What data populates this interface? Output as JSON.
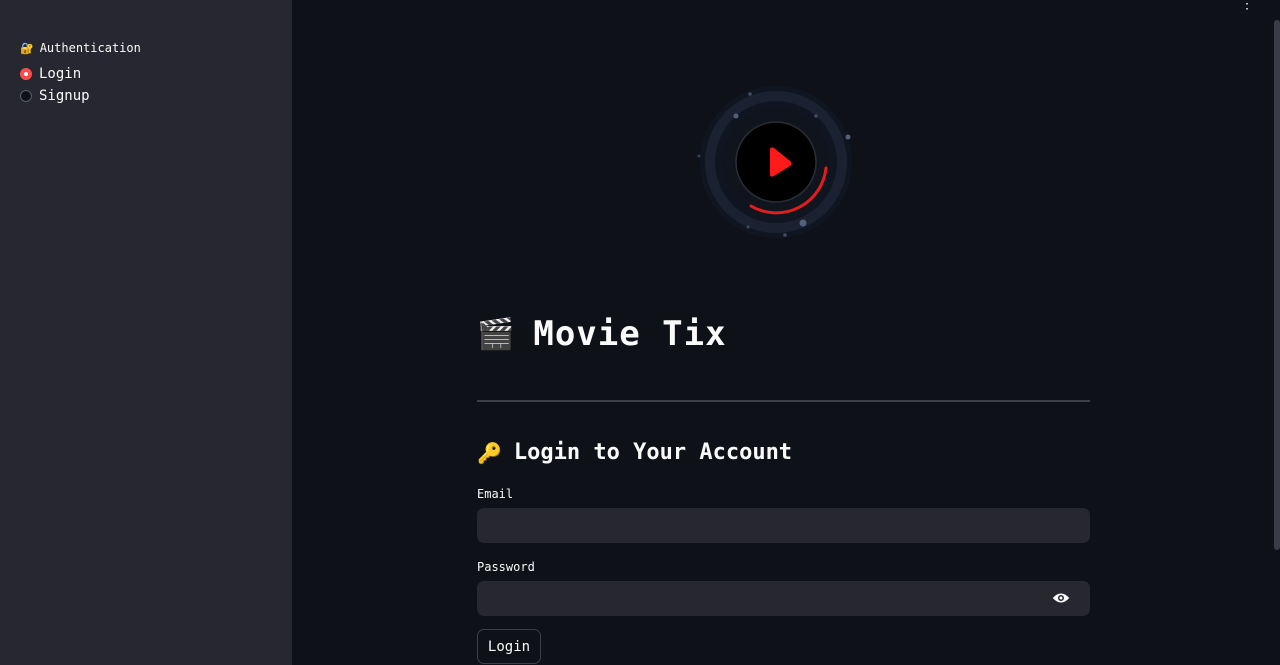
{
  "sidebar": {
    "title_emoji": "🔐",
    "title": "Authentication",
    "options": [
      {
        "label": "Login",
        "selected": true
      },
      {
        "label": "Signup",
        "selected": false
      }
    ]
  },
  "main": {
    "app_title_emoji": "🎬",
    "app_title": "Movie Tix",
    "section_emoji": "🔑",
    "section_title": "Login to Your Account",
    "email_label": "Email",
    "email_value": "",
    "password_label": "Password",
    "password_value": "",
    "login_button": "Login"
  },
  "colors": {
    "accent": "#ff4b4b",
    "background": "#0e1117",
    "sidebar_bg": "#262730",
    "input_bg": "#262730",
    "text": "#fafafa"
  },
  "icons": {
    "menu": "kebab-menu-icon",
    "password_toggle": "eye-icon",
    "logo": "play-icon"
  }
}
